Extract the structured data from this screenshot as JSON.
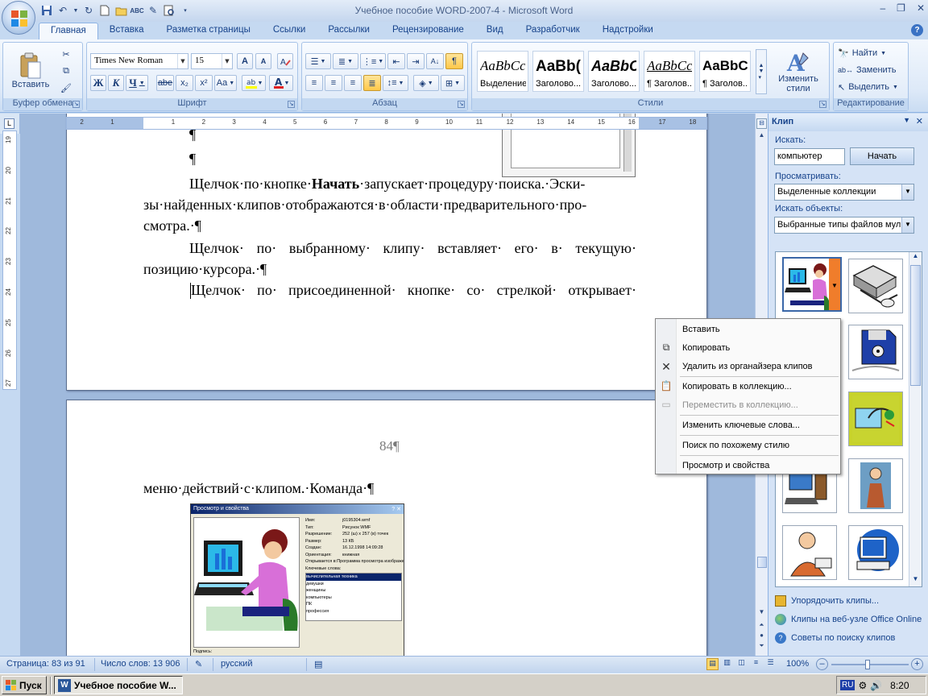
{
  "window": {
    "title": "Учебное пособие WORD-2007-4 - Microsoft Word"
  },
  "tabs": [
    "Главная",
    "Вставка",
    "Разметка страницы",
    "Ссылки",
    "Рассылки",
    "Рецензирование",
    "Вид",
    "Разработчик",
    "Надстройки"
  ],
  "ribbon": {
    "clipboard": {
      "label": "Буфер обмена",
      "paste": "Вставить"
    },
    "font": {
      "label": "Шрифт",
      "font_name": "Times New Roman",
      "font_size": "15",
      "bold": "Ж",
      "italic": "К",
      "underline": "Ч",
      "strike": "abe",
      "sub": "x₂",
      "sup": "x²",
      "case": "Aa",
      "grow": "A",
      "shrink": "A"
    },
    "paragraph": {
      "label": "Абзац",
      "pilcrow": "¶"
    },
    "styles": {
      "label": "Стили",
      "tiles": [
        {
          "sample": "AaBbCc",
          "name": "Выделение"
        },
        {
          "sample": "AaBb(",
          "name": "Заголово..."
        },
        {
          "sample": "AaBbC",
          "name": "Заголово..."
        },
        {
          "sample": "AaBbCc",
          "name": "¶ Заголов..."
        },
        {
          "sample": "AaBbC",
          "name": "¶ Заголов..."
        }
      ],
      "change_styles": "Изменить стили"
    },
    "editing": {
      "label": "Редактирование",
      "find": "Найти",
      "replace": "Заменить",
      "select": "Выделить"
    }
  },
  "ruler": {
    "h_ticks": [
      "2",
      "1",
      "1",
      "2",
      "3",
      "4",
      "5",
      "6",
      "7",
      "8",
      "9",
      "10",
      "11",
      "12",
      "13",
      "14",
      "15",
      "16",
      "17",
      "18"
    ],
    "v_ticks": [
      "19",
      "20",
      "21",
      "22",
      "23",
      "24",
      "25",
      "26",
      "27"
    ]
  },
  "document": {
    "pilcrow1": "¶",
    "pilcrow2": "¶",
    "p1_line1_a": "Щелчок·по·кнопке·",
    "p1_line1_bold": "Начать",
    "p1_line1_b": "·запускает·процедуру·поиска.·Эски-",
    "p1_line2": "зы·найденных·клипов·отображаются·в·области·предварительного·про-",
    "p1_line3": "смотра.·¶",
    "p2_line1": "Щелчок· по· выбранному· клипу· вставляет· его· в· текущую·",
    "p2_line2": "позицию·курсора.·¶",
    "p3_line1": "Щелчок· по· присоединенной· кнопке· со· стрелкой· открывает·",
    "page_number": "84¶",
    "p4_line1": "меню·действий·с·клипом.·Команда·¶",
    "dialog_title": "Просмотр и свойства",
    "dialog_fields": [
      "Имя:",
      "Тип:",
      "Разрешение:",
      "Размер:",
      "Создан:",
      "Ориентация:",
      "Открывается в:",
      "Ключевые слова:"
    ],
    "dialog_values": [
      "j0195304.wmf",
      "Рисунок WMF",
      "252 (ш) x 257 (в) точек",
      "13 КБ",
      "16.12.1998 14:09:28",
      "книжная",
      "Программа просмотра изображе"
    ],
    "dialog_keywords": [
      "вычислительная техника",
      "девушки",
      "женщины",
      "компьютеры",
      "ПК",
      "профессия"
    ],
    "dialog_caption": "Подпись:"
  },
  "taskpane": {
    "title": "Клип",
    "search_label": "Искать:",
    "search_value": "компьютер",
    "search_button": "Начать",
    "browse_label": "Просматривать:",
    "browse_value": "Выделенные коллекции",
    "types_label": "Искать объекты:",
    "types_value": "Выбранные типы файлов муль",
    "links": [
      "Упорядочить клипы...",
      "Клипы на веб-узле Office Online",
      "Советы по поиску клипов"
    ]
  },
  "context_menu": {
    "items": [
      {
        "label": "Вставить",
        "icon": "none",
        "disabled": false
      },
      {
        "label": "Копировать",
        "icon": "copy-icon",
        "disabled": false
      },
      {
        "label": "Удалить из органайзера клипов",
        "icon": "delete-icon",
        "disabled": false
      },
      {
        "label": "Копировать в коллекцию...",
        "icon": "copy-to-collection-icon",
        "disabled": false
      },
      {
        "label": "Переместить в коллекцию...",
        "icon": "move-to-collection-icon",
        "disabled": true
      },
      {
        "label": "Изменить ключевые слова...",
        "icon": "none",
        "disabled": false
      },
      {
        "label": "Поиск по похожему стилю",
        "icon": "none",
        "disabled": false
      },
      {
        "label": "Просмотр и свойства",
        "icon": "none",
        "disabled": false
      }
    ]
  },
  "statusbar": {
    "page": "Страница: 83 из 91",
    "words": "Число слов: 13 906",
    "language": "русский",
    "zoom": "100%"
  },
  "taskbar": {
    "start": "Пуск",
    "task": "Учебное пособие W...",
    "lang": "RU",
    "clock": "8:20"
  },
  "colors": {
    "ribbon_blue": "#c5d9f1",
    "accent": "#15428b",
    "clip_selected": "#f07d2b"
  }
}
